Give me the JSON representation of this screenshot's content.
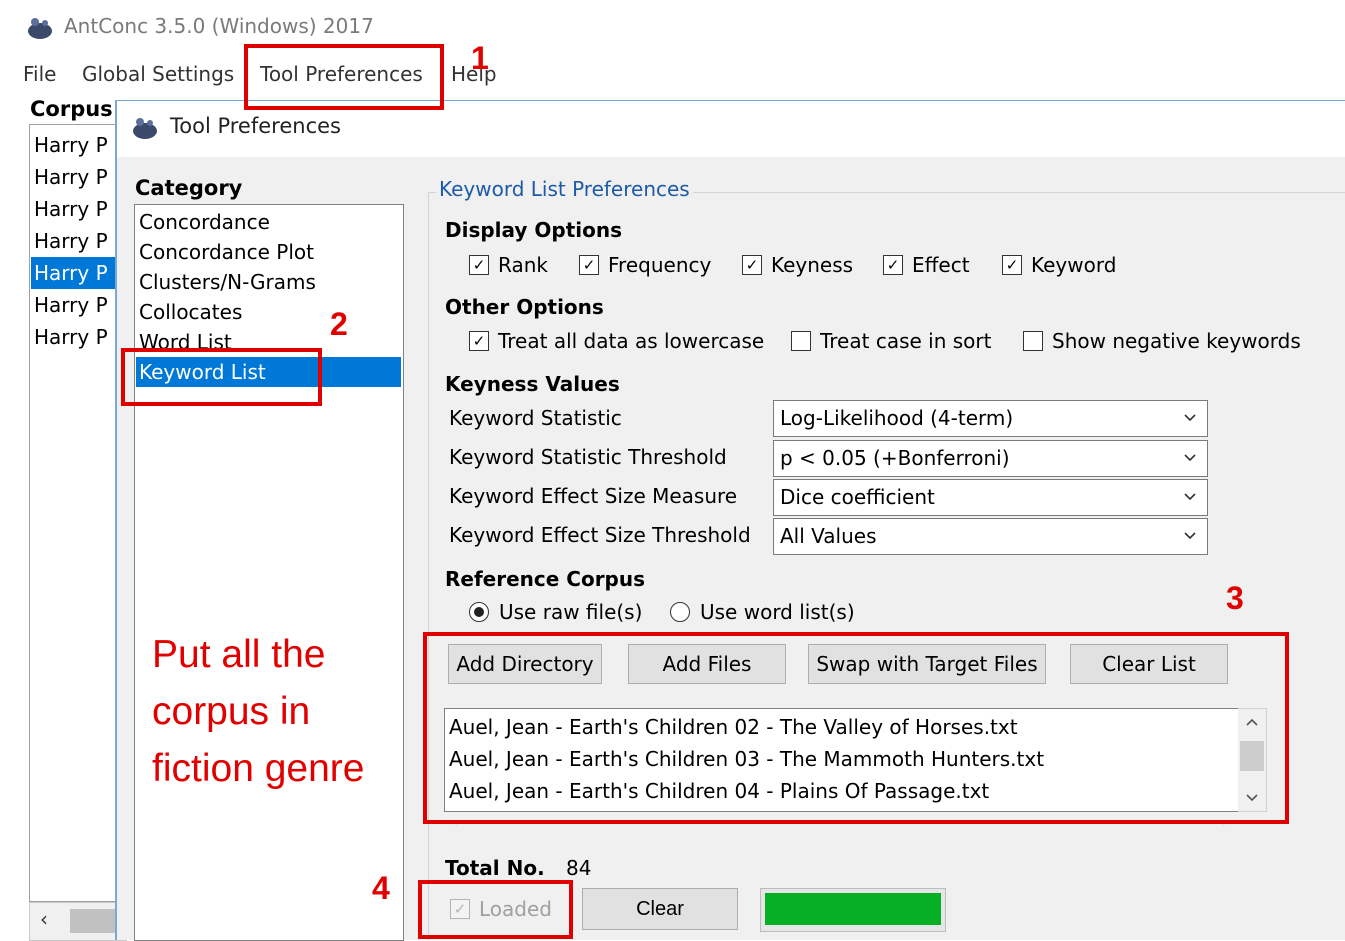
{
  "app": {
    "title": "AntConc 3.5.0 (Windows) 2017",
    "menu": [
      "File",
      "Global Settings",
      "Tool Preferences",
      "Help"
    ],
    "corpus_label": "Corpus",
    "corpus_files": [
      "Harry P",
      "Harry P",
      "Harry P",
      "Harry P",
      "Harry P",
      "Harry P",
      "Harry P"
    ],
    "selected_corpus_index": 4
  },
  "dialog": {
    "title": "Tool Preferences",
    "category_label": "Category",
    "categories": [
      "Concordance",
      "Concordance Plot",
      "Clusters/N-Grams",
      "Collocates",
      "Word List",
      "Keyword List"
    ],
    "selected_category": "Keyword List",
    "prefs_title": "Keyword List Preferences",
    "display_options": {
      "label": "Display Options",
      "items": [
        {
          "label": "Rank",
          "checked": true
        },
        {
          "label": "Frequency",
          "checked": true
        },
        {
          "label": "Keyness",
          "checked": true
        },
        {
          "label": "Effect",
          "checked": true
        },
        {
          "label": "Keyword",
          "checked": true
        }
      ]
    },
    "other_options": {
      "label": "Other Options",
      "items": [
        {
          "label": "Treat all data as lowercase",
          "checked": true
        },
        {
          "label": "Treat case in sort",
          "checked": false
        },
        {
          "label": "Show negative keywords",
          "checked": false
        }
      ]
    },
    "keyness_values": {
      "label": "Keyness Values",
      "rows": [
        {
          "label": "Keyword Statistic",
          "value": "Log-Likelihood (4-term)"
        },
        {
          "label": "Keyword Statistic Threshold",
          "value": "p < 0.05 (+Bonferroni)"
        },
        {
          "label": "Keyword Effect Size Measure",
          "value": "Dice coefficient"
        },
        {
          "label": "Keyword Effect Size Threshold",
          "value": "All Values"
        }
      ]
    },
    "reference_corpus": {
      "label": "Reference Corpus",
      "radio_raw": "Use raw file(s)",
      "radio_wordlist": "Use word list(s)",
      "selected": "raw",
      "buttons": {
        "add_directory": "Add Directory",
        "add_files": "Add Files",
        "swap": "Swap with Target Files",
        "clear_list": "Clear List"
      },
      "files": [
        "Auel, Jean - Earth's Children 02 - The Valley of Horses.txt",
        "Auel, Jean - Earth's Children 03 - The Mammoth Hunters.txt",
        "Auel, Jean - Earth's Children 04 - Plains Of Passage.txt"
      ],
      "total_label": "Total No.",
      "total_value": "84",
      "loaded_label": "Loaded",
      "loaded_checked": true,
      "clear_label": "Clear",
      "progress": 1.0
    }
  },
  "annotations": {
    "numbers": [
      "1",
      "2",
      "3",
      "4"
    ],
    "note": "Put all the corpus in fiction genre",
    "color": "#e00000"
  },
  "colors": {
    "selection": "#0078d7",
    "progress": "#06b025",
    "legend": "#1c5aa8"
  }
}
